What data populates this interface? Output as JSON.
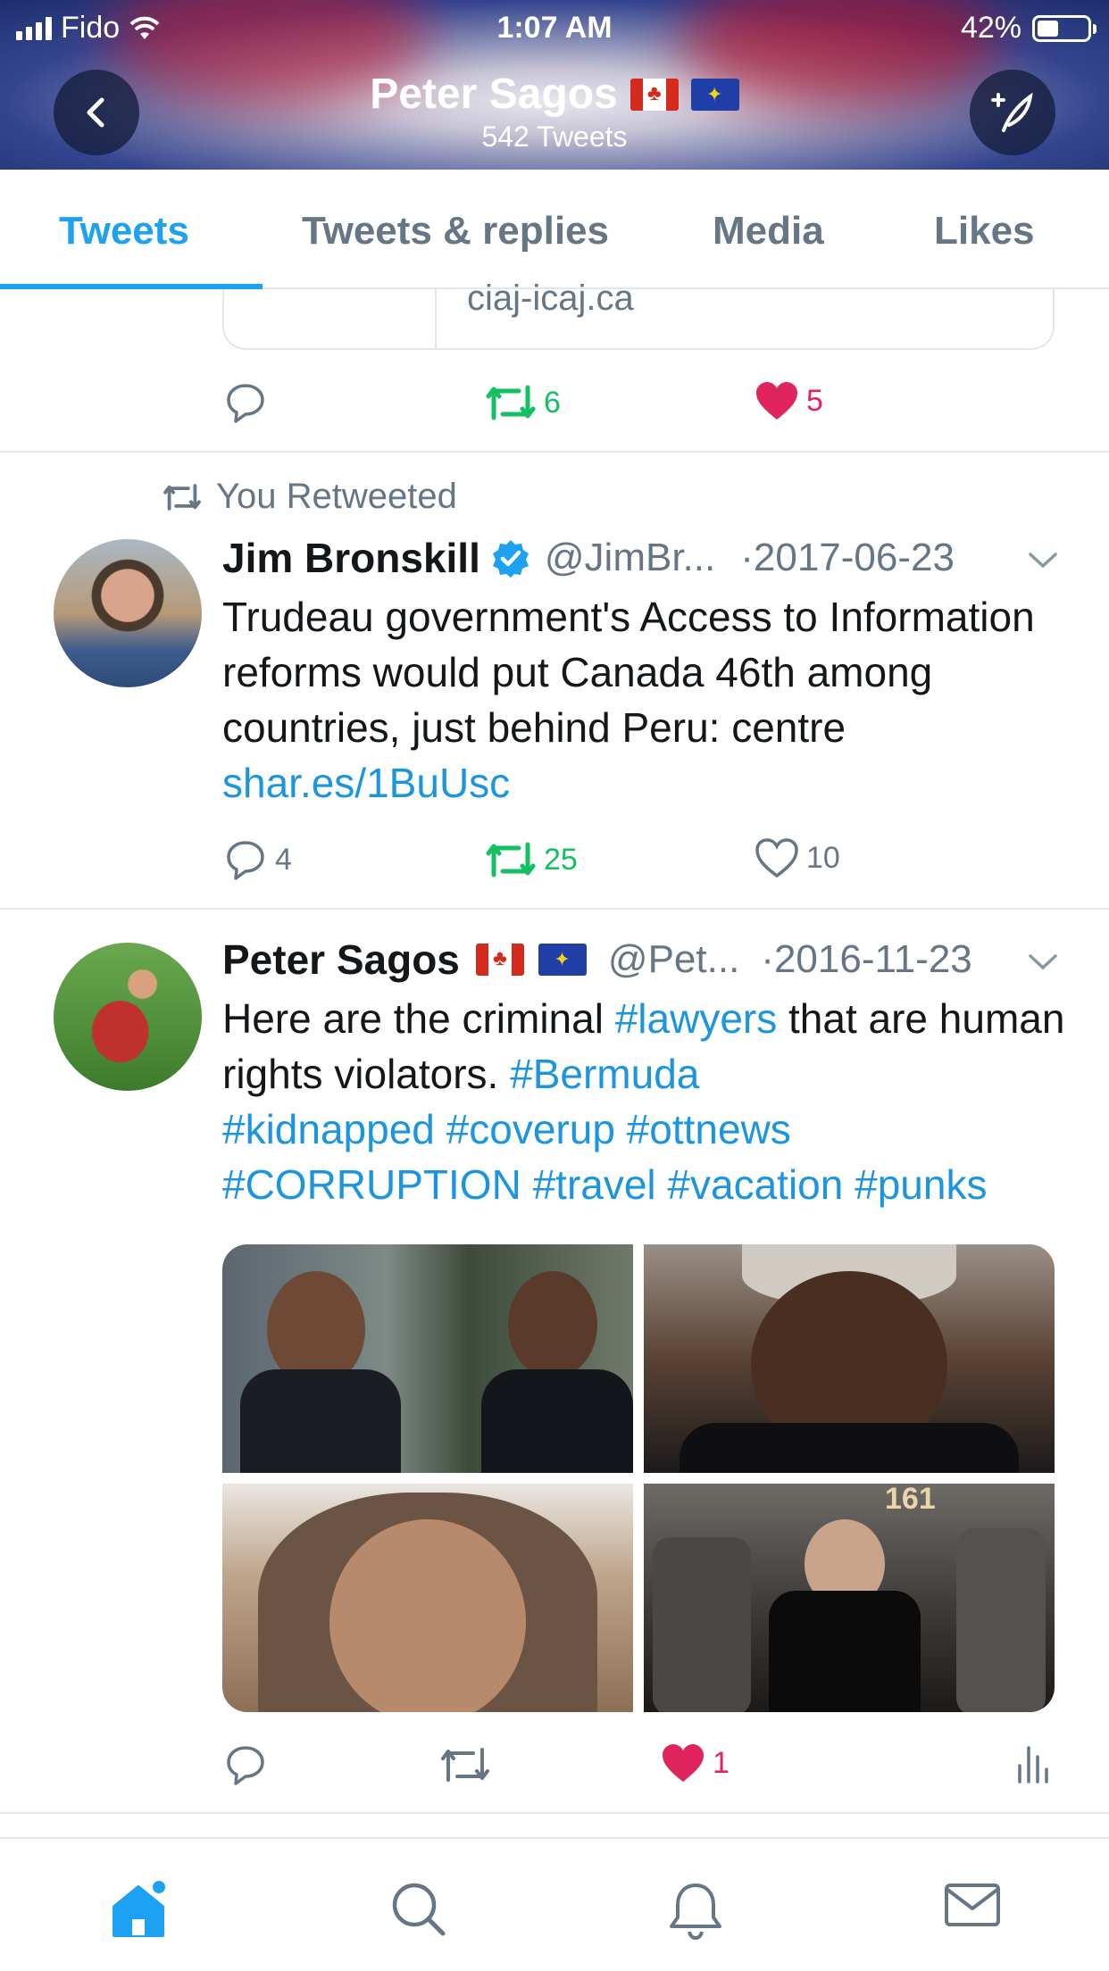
{
  "status_bar": {
    "carrier": "Fido",
    "time": "1:07 AM",
    "battery": "42%"
  },
  "header": {
    "name": "Peter Sagos",
    "tweet_count": "542 Tweets"
  },
  "tabs": [
    {
      "label": "Tweets",
      "active": true
    },
    {
      "label": "Tweets & replies",
      "active": false
    },
    {
      "label": "Media",
      "active": false
    },
    {
      "label": "Likes",
      "active": false
    }
  ],
  "prev_tweet": {
    "card_domain": "ciaj-icaj.ca",
    "retweets": "6",
    "likes": "5"
  },
  "tweet1": {
    "retweeted_label": "You Retweeted",
    "author": "Jim Bronskill",
    "handle": "@JimBr...",
    "date": "·2017-06-23",
    "text": "Trudeau government's Access to Information reforms would put Canada 46th among countries, just behind Peru: centre ",
    "link": "shar.es/1BuUsc",
    "replies": "4",
    "retweets": "25",
    "likes": "10"
  },
  "tweet2": {
    "author": "Peter Sagos",
    "handle": "@Pet...",
    "date": "·2016-11-23",
    "text_pre": "Here are the criminal ",
    "tag_lawyers": "#lawyers",
    "text_mid": " that are human rights violators. ",
    "tag_bermuda": "#Bermuda",
    "tags_line3": "#kidnapped #coverup #ottnews",
    "tags_line4": "#CORRUPTION #travel #vacation #punks",
    "photo_sign": "161",
    "likes": "1"
  },
  "colors": {
    "accent": "#1da1f2",
    "retweet_green": "#17bf63",
    "like_red": "#e0245e",
    "gray": "#657786"
  }
}
